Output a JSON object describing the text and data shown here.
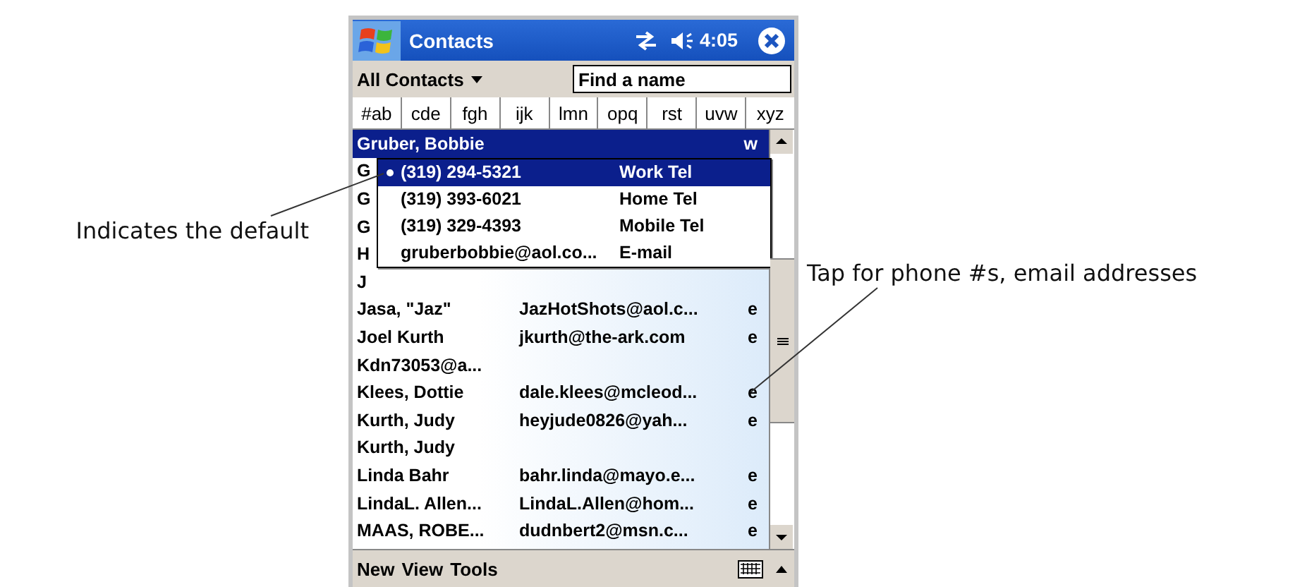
{
  "annotations": {
    "left": "Indicates the default",
    "right": "Tap for phone #s, email addresses"
  },
  "title_bar": {
    "title": "Contacts",
    "time": "4:05"
  },
  "filter": {
    "category": "All Contacts",
    "search_placeholder": "Find a name"
  },
  "letter_tabs": [
    {
      "label": "#ab",
      "selected": false
    },
    {
      "label": "cde",
      "selected": false
    },
    {
      "label": "fgh",
      "selected": false
    },
    {
      "label": "ijk",
      "selected": false
    },
    {
      "label": "lmn",
      "selected": false
    },
    {
      "label": "opq",
      "selected": false
    },
    {
      "label": "rst",
      "selected": false
    },
    {
      "label": "uvw",
      "selected": false
    },
    {
      "label": "xyz",
      "selected": false
    }
  ],
  "contacts": [
    {
      "name": "Gruber, Bobbie",
      "type": "w",
      "selected": true
    },
    {
      "name": "G",
      "selected": false
    },
    {
      "name": "G",
      "selected": false
    },
    {
      "name": "G",
      "selected": false
    },
    {
      "name": "H",
      "selected": false
    },
    {
      "name": "J",
      "selected": false
    },
    {
      "name": "Jasa, \"Jaz\"",
      "detail": "JazHotShots@aol.c...",
      "type": "e",
      "selected": false
    },
    {
      "name": "Joel Kurth",
      "detail": "jkurth@the-ark.com",
      "type": "e",
      "selected": false
    },
    {
      "name": "Kdn73053@a...",
      "selected": false
    },
    {
      "name": "Klees, Dottie",
      "detail": "dale.klees@mcleod...",
      "type": "e",
      "selected": false
    },
    {
      "name": "Kurth, Judy",
      "detail": "heyjude0826@yah...",
      "type": "e",
      "selected": false
    },
    {
      "name": "Kurth, Judy",
      "selected": false
    },
    {
      "name": "Linda Bahr",
      "detail": "bahr.linda@mayo.e...",
      "type": "e",
      "selected": false
    },
    {
      "name": "LindaL. Allen...",
      "detail": "LindaL.Allen@hom...",
      "type": "e",
      "selected": false
    },
    {
      "name": "MAAS, ROBE...",
      "detail": "dudnbert2@msn.c...",
      "type": "e",
      "selected": false
    }
  ],
  "popup": [
    {
      "value": "(319) 294-5321",
      "label": "Work Tel",
      "default": true,
      "selected": true
    },
    {
      "value": "(319) 393-6021",
      "label": "Home Tel",
      "default": false,
      "selected": false
    },
    {
      "value": "(319) 329-4393",
      "label": "Mobile Tel",
      "default": false,
      "selected": false
    },
    {
      "value": "gruberbobbie@aol.co...",
      "label": "E-mail",
      "default": false,
      "selected": false
    }
  ],
  "menu_bar": [
    "New",
    "View",
    "Tools"
  ]
}
